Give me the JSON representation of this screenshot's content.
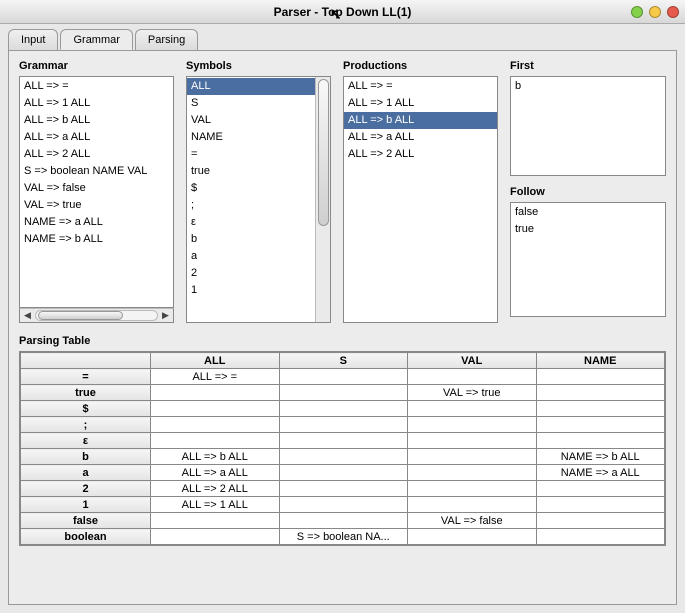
{
  "window": {
    "title": "Parser - Top Down LL(1)"
  },
  "tabs": {
    "items": [
      "Input",
      "Grammar",
      "Parsing"
    ],
    "active": 1
  },
  "labels": {
    "grammar": "Grammar",
    "symbols": "Symbols",
    "productions": "Productions",
    "first": "First",
    "follow": "Follow",
    "parsing_table": "Parsing Table"
  },
  "grammar": {
    "items": [
      "ALL => =",
      "ALL => 1 ALL",
      "ALL => b ALL",
      "ALL => a ALL",
      "ALL => 2 ALL",
      "S => boolean NAME VAL",
      "VAL => false",
      "VAL => true",
      "NAME => a ALL",
      "NAME => b ALL"
    ],
    "selected": -1
  },
  "symbols": {
    "items": [
      "ALL",
      "S",
      "VAL",
      "NAME",
      "=",
      "true",
      "$",
      ";",
      "ε",
      "b",
      "a",
      "2",
      "1"
    ],
    "selected": 0
  },
  "productions": {
    "items": [
      "ALL => =",
      "ALL => 1 ALL",
      "ALL => b ALL",
      "ALL => a ALL",
      "ALL => 2 ALL"
    ],
    "selected": 2
  },
  "first": {
    "items": [
      "b"
    ]
  },
  "follow": {
    "items": [
      "false",
      "true"
    ]
  },
  "parsing_table": {
    "columns": [
      "ALL",
      "S",
      "VAL",
      "NAME"
    ],
    "rows": [
      {
        "key": "=",
        "cells": [
          "ALL => =",
          "",
          "",
          ""
        ]
      },
      {
        "key": "true",
        "cells": [
          "",
          "",
          "VAL => true",
          ""
        ]
      },
      {
        "key": "$",
        "cells": [
          "",
          "",
          "",
          ""
        ]
      },
      {
        "key": ";",
        "cells": [
          "",
          "",
          "",
          ""
        ]
      },
      {
        "key": "ε",
        "cells": [
          "",
          "",
          "",
          ""
        ]
      },
      {
        "key": "b",
        "cells": [
          "ALL => b ALL",
          "",
          "",
          "NAME => b ALL"
        ]
      },
      {
        "key": "a",
        "cells": [
          "ALL => a ALL",
          "",
          "",
          "NAME => a ALL"
        ]
      },
      {
        "key": "2",
        "cells": [
          "ALL => 2 ALL",
          "",
          "",
          ""
        ]
      },
      {
        "key": "1",
        "cells": [
          "ALL => 1 ALL",
          "",
          "",
          ""
        ]
      },
      {
        "key": "false",
        "cells": [
          "",
          "",
          "VAL => false",
          ""
        ]
      },
      {
        "key": "boolean",
        "cells": [
          "",
          "S => boolean NA...",
          "",
          ""
        ]
      }
    ]
  }
}
